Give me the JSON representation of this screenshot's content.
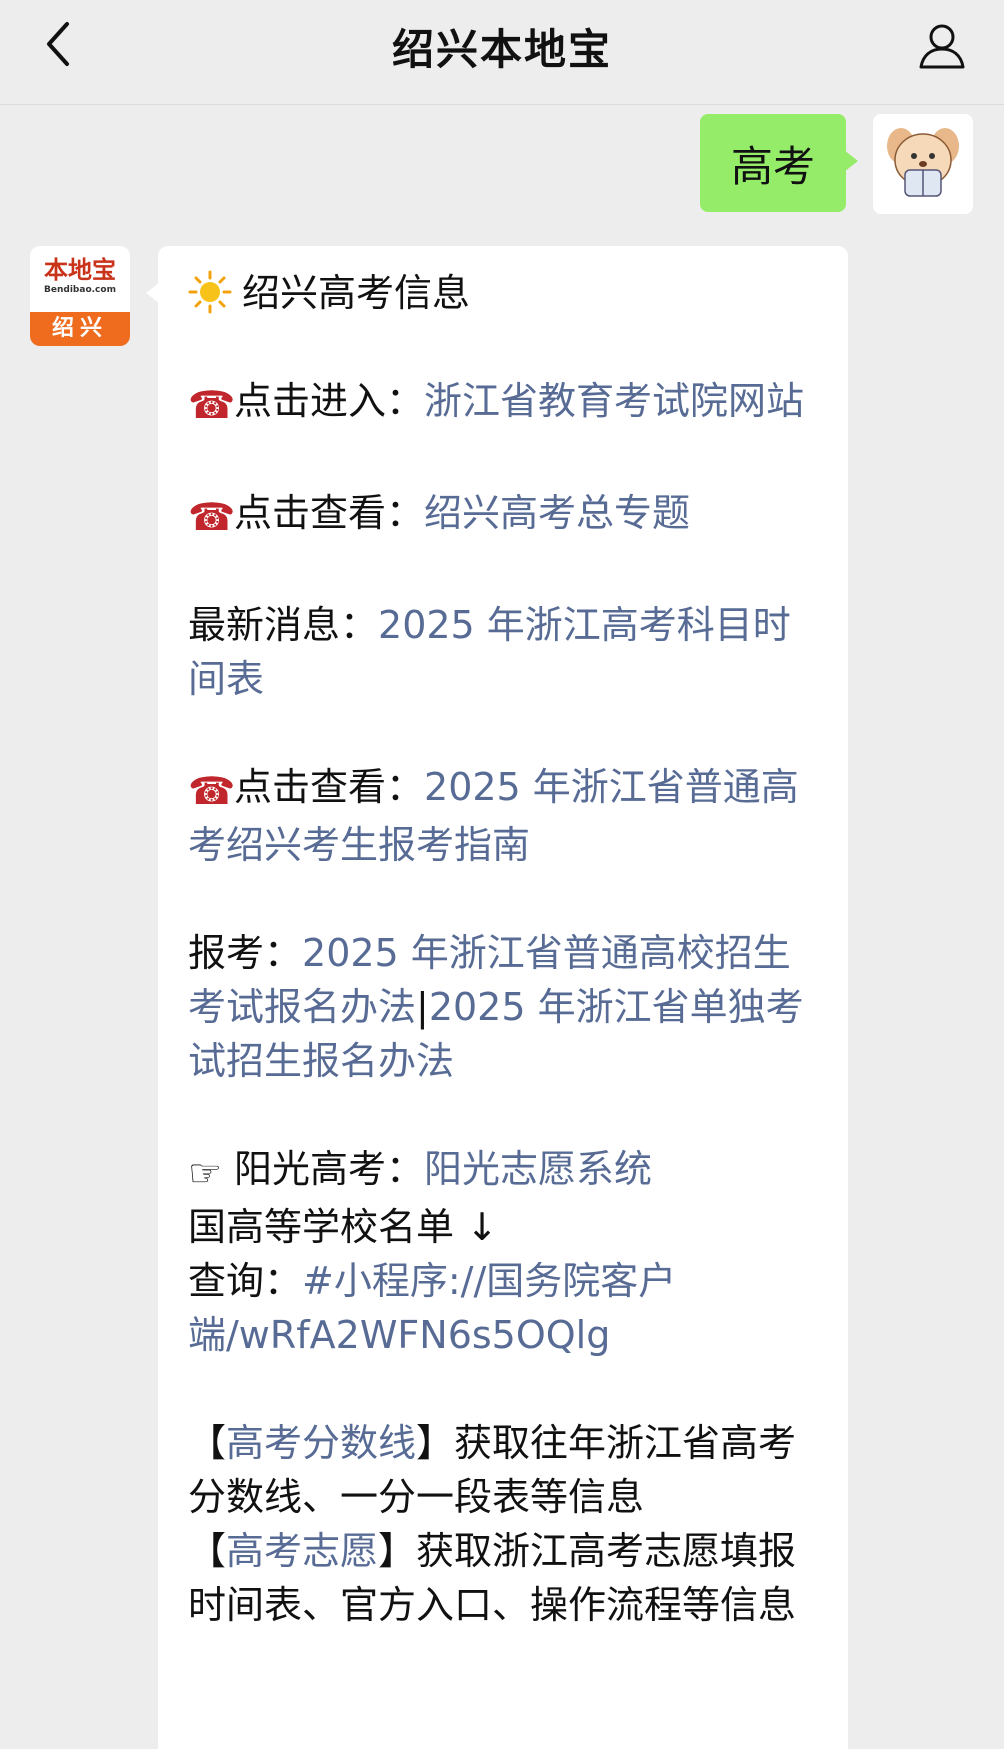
{
  "header": {
    "title": "绍兴本地宝",
    "back_icon": "chevron-left-icon",
    "profile_icon": "person-icon"
  },
  "outgoing": {
    "text": "高考"
  },
  "bot": {
    "logo_text": "本地宝",
    "logo_url": "Bendibao.com",
    "logo_city": "绍兴"
  },
  "message": {
    "headline": "绍兴高考信息",
    "item1_label": "点击进入：",
    "item1_link": "浙江省教育考试院网站",
    "item2_label": "点击查看：",
    "item2_link": "绍兴高考总专题",
    "item3_label": "最新消息：",
    "item3_link": "2025 年浙江高考科目时间表",
    "item4_label": "点击查看：",
    "item4_link": "2025 年浙江省普通高考绍兴考生报考指南",
    "item5_label": "报考：",
    "item5_link1": "2025 年浙江省普通高校招生考试报名办法",
    "item5_sep": "|",
    "item5_link2": "2025 年浙江省单独考试招生报名办法",
    "item6_label": "阳光高考：",
    "item6_link": "阳光志愿系统",
    "item6_line2": "国高等学校名单 ↓",
    "item6_query_label": "查询：",
    "item6_query_link": "#小程序://国务院客户端/wRfA2WFN6s5OQlg",
    "kw1_open": "【",
    "kw1_link": "高考分数线",
    "kw1_close": "】",
    "kw1_text": "获取往年浙江省高考分数线、一分一段表等信息",
    "kw2_open": "【",
    "kw2_link": "高考志愿",
    "kw2_close": "】",
    "kw2_text": "获取浙江高考志愿填报时间表、官方入口、操作流程等信息",
    "phone_icon": "☎",
    "point_icon": "☞"
  },
  "colors": {
    "background": "#ededed",
    "outgoing_bubble": "#95ec69",
    "link": "#576b95",
    "phone_icon": "#c0262b",
    "logo_orange": "#ef6c1e"
  }
}
